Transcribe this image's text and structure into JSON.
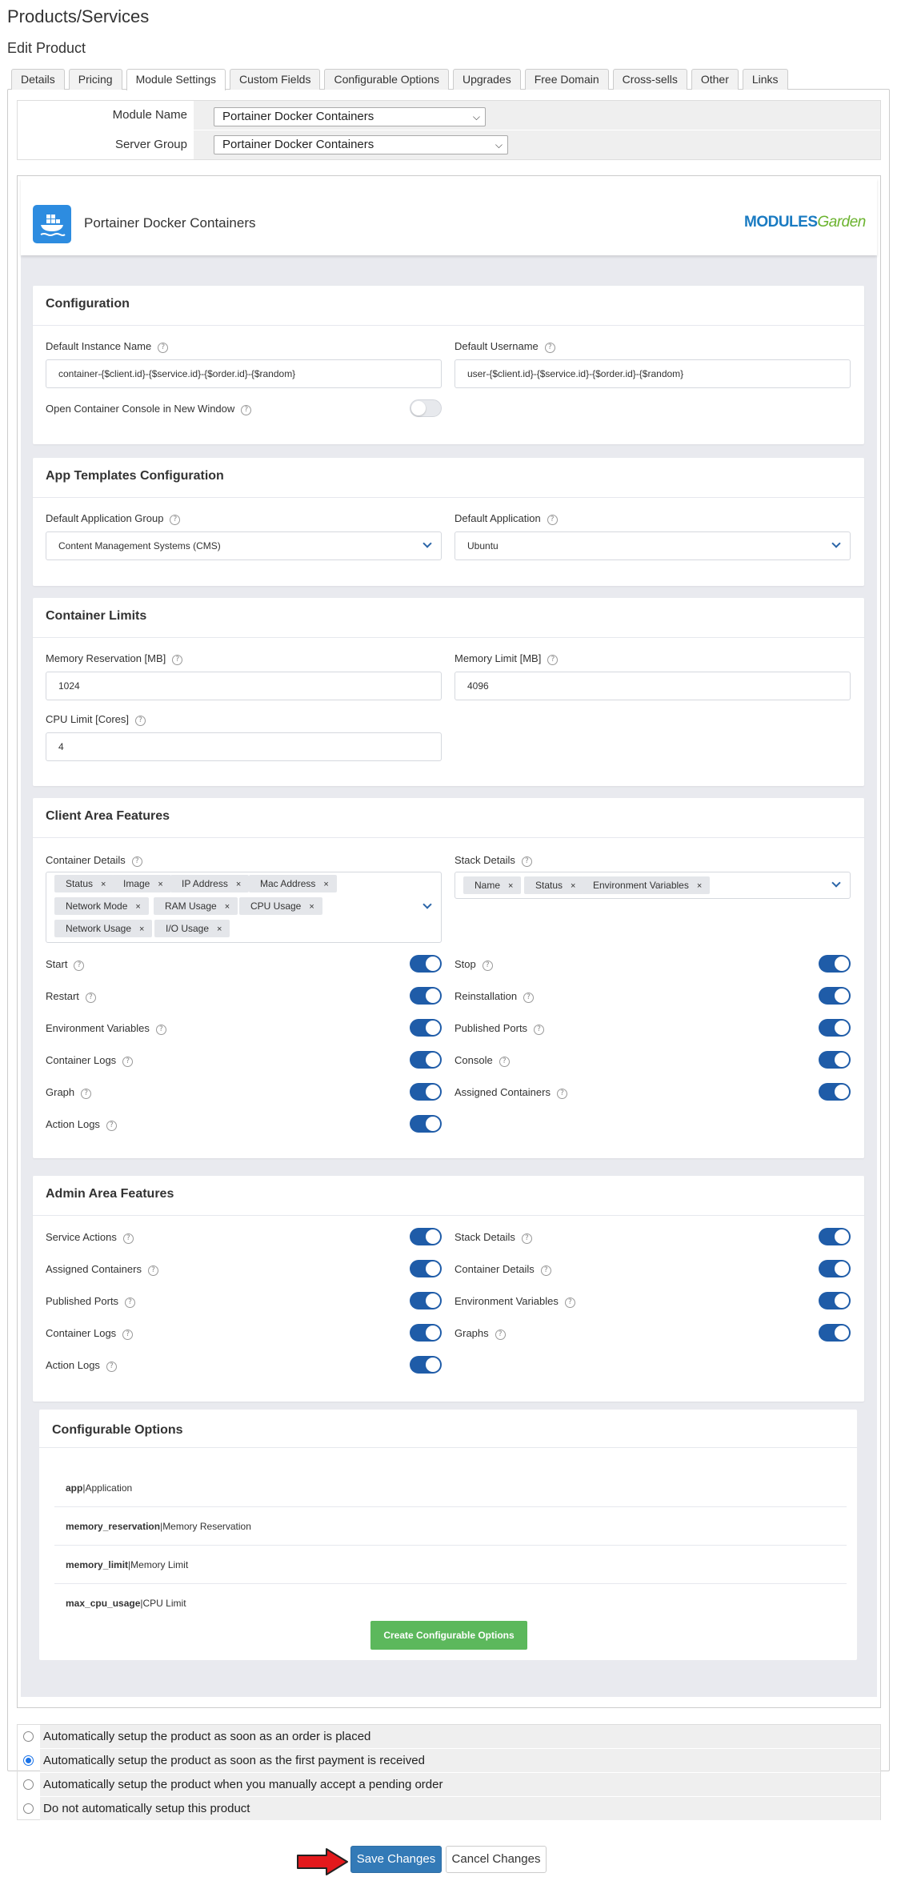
{
  "page": {
    "title": "Products/Services",
    "subtitle": "Edit Product"
  },
  "tabs": [
    "Details",
    "Pricing",
    "Module Settings",
    "Custom Fields",
    "Configurable Options",
    "Upgrades",
    "Free Domain",
    "Cross-sells",
    "Other",
    "Links"
  ],
  "active_tab": "Module Settings",
  "module": {
    "module_name_label": "Module Name",
    "module_name_value": "Portainer Docker Containers",
    "server_group_label": "Server Group",
    "server_group_value": "Portainer Docker Containers"
  },
  "mg": {
    "title": "Portainer Docker Containers",
    "brand_main": "MODULES",
    "brand_accent": "Garden"
  },
  "configuration": {
    "title": "Configuration",
    "instance_name_label": "Default Instance Name",
    "instance_name_value": "container-{$client.id}-{$service.id}-{$order.id}-{$random}",
    "username_label": "Default Username",
    "username_value": "user-{$client.id}-{$service.id}-{$order.id}-{$random}",
    "console_label": "Open Container Console in New Window",
    "console_enabled": false
  },
  "app_templates": {
    "title": "App Templates Configuration",
    "group_label": "Default Application Group",
    "group_value": "Content Management Systems (CMS)",
    "app_label": "Default Application",
    "app_value": "Ubuntu"
  },
  "limits": {
    "title": "Container Limits",
    "mem_res_label": "Memory Reservation [MB]",
    "mem_res_value": "1024",
    "mem_limit_label": "Memory Limit [MB]",
    "mem_limit_value": "4096",
    "cpu_label": "CPU Limit [Cores]",
    "cpu_value": "4"
  },
  "client_features": {
    "title": "Client Area Features",
    "container_details_label": "Container Details",
    "container_details": [
      "Status",
      "Image",
      "IP Address",
      "Mac Address",
      "Network Mode",
      "RAM Usage",
      "CPU Usage",
      "Network Usage",
      "I/O Usage"
    ],
    "stack_details_label": "Stack Details",
    "stack_details": [
      "Name",
      "Status",
      "Environment Variables"
    ],
    "toggles_left": [
      "Start",
      "Restart",
      "Environment Variables",
      "Container Logs",
      "Graph",
      "Action Logs"
    ],
    "toggles_right": [
      "Stop",
      "Reinstallation",
      "Published Ports",
      "Console",
      "Assigned Containers"
    ]
  },
  "admin_features": {
    "title": "Admin Area Features",
    "toggles_left": [
      "Service Actions",
      "Assigned Containers",
      "Published Ports",
      "Container Logs",
      "Action Logs"
    ],
    "toggles_right": [
      "Stack Details",
      "Container Details",
      "Environment Variables",
      "Graphs"
    ]
  },
  "configurable_options": {
    "title": "Configurable Options",
    "rows": [
      {
        "key": "app",
        "label": "Application"
      },
      {
        "key": "memory_reservation",
        "label": "Memory Reservation"
      },
      {
        "key": "memory_limit",
        "label": "Memory Limit"
      },
      {
        "key": "max_cpu_usage",
        "label": "CPU Limit"
      }
    ],
    "create_button": "Create Configurable Options"
  },
  "setup_options": [
    {
      "label": "Automatically setup the product as soon as an order is placed",
      "selected": false
    },
    {
      "label": "Automatically setup the product as soon as the first payment is received",
      "selected": true
    },
    {
      "label": "Automatically setup the product when you manually accept a pending order",
      "selected": false
    },
    {
      "label": "Do not automatically setup this product",
      "selected": false
    }
  ],
  "buttons": {
    "save": "Save Changes",
    "cancel": "Cancel Changes"
  },
  "colors": {
    "toggle_on": "#1f5ca8",
    "create_button": "#5cb85c",
    "save_button": "#337ab7",
    "arrow": "#e3191c"
  }
}
